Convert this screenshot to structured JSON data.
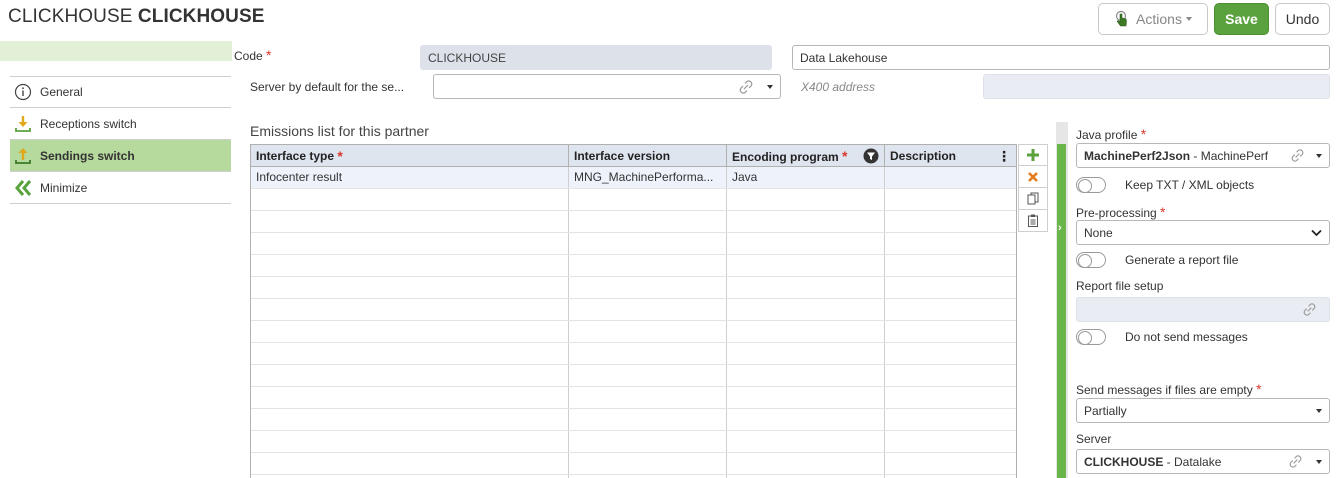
{
  "header": {
    "title_prefix": "CLICKHOUSE",
    "title_bold": "CLICKHOUSE",
    "actions_label": "Actions",
    "save_label": "Save",
    "undo_label": "Undo"
  },
  "menu": {
    "items": [
      {
        "label": "General",
        "icon": "info-icon"
      },
      {
        "label": "Receptions switch",
        "icon": "download-icon"
      },
      {
        "label": "Sendings switch",
        "icon": "upload-icon"
      },
      {
        "label": "Minimize",
        "icon": "double-chevron-left-icon"
      }
    ]
  },
  "form": {
    "code_label": "Code",
    "code_value": "CLICKHOUSE",
    "name_value": "Data Lakehouse",
    "server_default_label": "Server by default for the se...",
    "server_default_value": "",
    "x400_placeholder": "X400 address"
  },
  "emissions": {
    "title": "Emissions list for this partner",
    "columns": [
      "Interface type",
      "Interface version",
      "Encoding program",
      "Description"
    ],
    "rows": [
      [
        "Infocenter result",
        "MNG_MachinePerforma...",
        "Java",
        ""
      ]
    ]
  },
  "right_panel": {
    "java_profile_label": "Java profile",
    "java_profile_code": "MachinePerf2Json",
    "java_profile_name": " - MachinePerf",
    "keep_objects_label": "Keep TXT / XML objects",
    "preprocessing_label": "Pre-processing",
    "preprocessing_value": "None",
    "generate_report_label": "Generate a report file",
    "report_setup_label": "Report file setup",
    "do_not_send_label": "Do not send messages",
    "send_empty_label": "Send messages if files are empty",
    "send_empty_value": "Partially",
    "server_label": "Server",
    "server_code": "CLICKHOUSE",
    "server_name": " - Datalake"
  },
  "colors": {
    "accent_green": "#5aa23e",
    "active_menu": "#b6d99d",
    "required": "#d9372b"
  }
}
